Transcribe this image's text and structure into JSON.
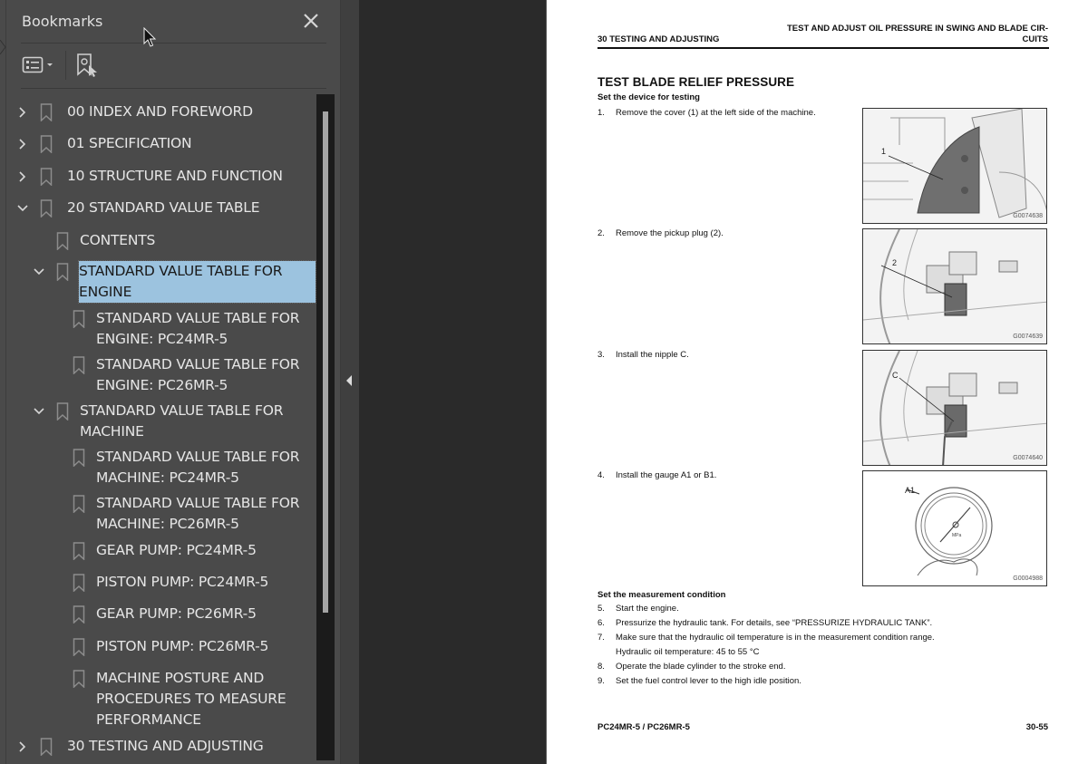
{
  "sidebar": {
    "title": "Bookmarks",
    "close_icon": "close-icon",
    "toolbar": {
      "options_icon": "list-options-icon",
      "add_bookmark_icon": "add-bookmark-icon"
    },
    "tree": [
      {
        "label": "00 INDEX AND FOREWORD",
        "level": 0,
        "expander": "collapsed"
      },
      {
        "label": "01 SPECIFICATION",
        "level": 0,
        "expander": "collapsed"
      },
      {
        "label": "10 STRUCTURE AND FUNCTION",
        "level": 0,
        "expander": "collapsed"
      },
      {
        "label": "20 STANDARD VALUE TABLE",
        "level": 0,
        "expander": "expanded"
      },
      {
        "label": "CONTENTS",
        "level": 1,
        "expander": "none"
      },
      {
        "label": " STANDARD VALUE TABLE FOR\nENGINE",
        "level": 1,
        "expander": "expanded",
        "selected": true
      },
      {
        "label": " STANDARD VALUE TABLE FOR\nENGINE: PC24MR-5",
        "level": 2,
        "expander": "none"
      },
      {
        "label": " STANDARD VALUE TABLE FOR\nENGINE: PC26MR-5",
        "level": 2,
        "expander": "none"
      },
      {
        "label": " STANDARD VALUE TABLE FOR\nMACHINE",
        "level": 1,
        "expander": "expanded"
      },
      {
        "label": " STANDARD VALUE TABLE FOR\nMACHINE: PC24MR-5",
        "level": 2,
        "expander": "none"
      },
      {
        "label": " STANDARD VALUE TABLE FOR\nMACHINE: PC26MR-5",
        "level": 2,
        "expander": "none"
      },
      {
        "label": " GEAR PUMP: PC24MR-5",
        "level": 2,
        "expander": "none"
      },
      {
        "label": " PISTON PUMP: PC24MR-5",
        "level": 2,
        "expander": "none"
      },
      {
        "label": " GEAR PUMP: PC26MR-5",
        "level": 2,
        "expander": "none"
      },
      {
        "label": " PISTON PUMP: PC26MR-5",
        "level": 2,
        "expander": "none"
      },
      {
        "label": " MACHINE POSTURE AND\nPROCEDURES TO MEASURE\nPERFORMANCE",
        "level": 2,
        "expander": "none"
      },
      {
        "label": "30 TESTING AND ADJUSTING",
        "level": 0,
        "expander": "collapsed"
      }
    ],
    "scroll_position_fraction": 0.03,
    "scroll_visible_fraction": 0.75
  },
  "viewer": {
    "collapse_icon": "collapse-panel-icon",
    "page": {
      "header_left": "30 TESTING AND ADJUSTING",
      "header_right_line1": "TEST AND ADJUST OIL PRESSURE IN SWING AND BLADE CIR-",
      "header_right_line2": "CUITS",
      "title": "TEST BLADE RELIEF PRESSURE",
      "section1": "Set the device for testing",
      "steps1": [
        {
          "num": "1.",
          "text": "Remove the cover (1) at the left side of the machine."
        },
        {
          "num": "2.",
          "text": "Remove the pickup plug (2)."
        },
        {
          "num": "3.",
          "text": "Install the nipple C."
        },
        {
          "num": "4.",
          "text": "Install the gauge A1 or B1."
        }
      ],
      "figures": [
        {
          "id": "G0074638",
          "callout": "1"
        },
        {
          "id": "G0074639",
          "callout": "2"
        },
        {
          "id": "G0074640",
          "callout": "C"
        },
        {
          "id": "G0004988",
          "callout": "A1",
          "gauge_unit": "MPa"
        }
      ],
      "section2": "Set the measurement condition",
      "steps2": [
        {
          "num": "5.",
          "text": "Start the engine."
        },
        {
          "num": "6.",
          "text": "Pressurize the hydraulic tank. For details, see “PRESSURIZE HYDRAULIC TANK”."
        },
        {
          "num": "7.",
          "text": "Make sure that the hydraulic oil temperature is in the measurement condition range."
        },
        {
          "num": "",
          "text": "Hydraulic oil temperature: 45 to 55 °C"
        },
        {
          "num": "8.",
          "text": "Operate the blade cylinder to the stroke end."
        },
        {
          "num": "9.",
          "text": "Set the fuel control lever to the high idle position."
        }
      ],
      "footer_left": "PC24MR-5 / PC26MR-5",
      "footer_right": "30-55"
    }
  },
  "colors": {
    "panel_bg": "#4a4a4a",
    "viewer_bg": "#2a2a2a",
    "selection": "#9cc3df",
    "text_light": "#e6e6e6"
  }
}
